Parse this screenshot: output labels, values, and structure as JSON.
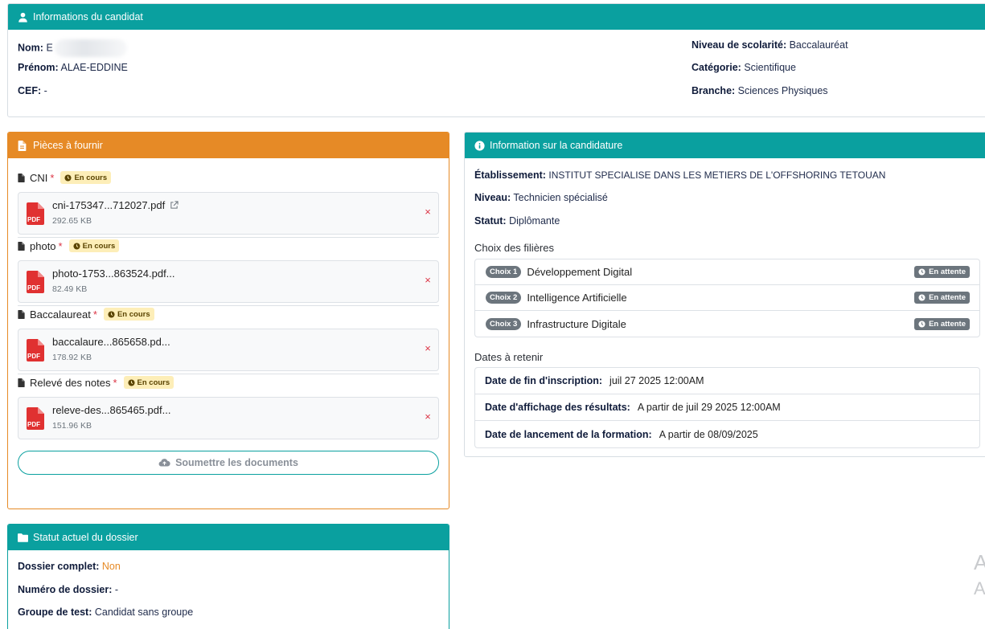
{
  "candidate": {
    "title": "Informations du candidat",
    "nom_label": "Nom:",
    "nom_value": "E",
    "prenom_label": "Prénom:",
    "prenom_value": "ALAE-EDDINE",
    "cef_label": "CEF:",
    "cef_value": "-",
    "niveau_scolarite_label": "Niveau de scolarité:",
    "niveau_scolarite_value": "Baccalauréat",
    "categorie_label": "Catégorie:",
    "categorie_value": "Scientifique",
    "branche_label": "Branche:",
    "branche_value": "Sciences Physiques"
  },
  "documents": {
    "title": "Pièces à fournir",
    "required_mark": "*",
    "items": [
      {
        "label": "CNI",
        "status": "En cours",
        "file_name": "cni-175347...712027.pdf",
        "file_size": "292.65 KB",
        "pdf_label": "PDF"
      },
      {
        "label": "photo",
        "status": "En cours",
        "file_name": "photo-1753...863524.pdf...",
        "file_size": "82.49 KB",
        "pdf_label": "PDF"
      },
      {
        "label": "Baccalaureat",
        "status": "En cours",
        "file_name": "baccalaure...865658.pd...",
        "file_size": "178.92 KB",
        "pdf_label": "PDF"
      },
      {
        "label": "Relevé des notes",
        "status": "En cours",
        "file_name": "releve-des...865465.pdf...",
        "file_size": "151.96 KB",
        "pdf_label": "PDF"
      }
    ],
    "remove_symbol": "×",
    "submit_label": "Soumettre les documents"
  },
  "application": {
    "title": "Information sur la candidature",
    "etablissement_label": "Établissement:",
    "etablissement_value": "INSTITUT SPECIALISE DANS LES METIERS DE L'OFFSHORING TETOUAN",
    "niveau_label": "Niveau:",
    "niveau_value": "Technicien spécialisé",
    "statut_label": "Statut:",
    "statut_value": "Diplômante",
    "filieres_title": "Choix des filières",
    "filieres": [
      {
        "choice": "Choix 1",
        "name": "Développement Digital",
        "status": "En attente"
      },
      {
        "choice": "Choix 2",
        "name": "Intelligence Artificielle",
        "status": "En attente"
      },
      {
        "choice": "Choix 3",
        "name": "Infrastructure Digitale",
        "status": "En attente"
      }
    ],
    "dates_title": "Dates à retenir",
    "dates": [
      {
        "label": "Date de fin d'inscription:",
        "value": "juil 27 2025 12:00AM"
      },
      {
        "label": "Date d'affichage des résultats:",
        "value": "A partir de juil 29 2025 12:00AM"
      },
      {
        "label": "Date de lancement de la formation:",
        "value": "A partir de 08/09/2025"
      }
    ]
  },
  "dossier": {
    "title": "Statut actuel du dossier",
    "complet_label": "Dossier complet:",
    "complet_value": "Non",
    "numero_label": "Numéro de dossier:",
    "numero_value": "-",
    "groupe_label": "Groupe de test:",
    "groupe_value": "Candidat sans groupe"
  },
  "watermark": {
    "line1": "A",
    "line2": "A"
  },
  "colors": {
    "teal": "#0aa09f",
    "orange": "#e68a26",
    "danger": "#dc3545",
    "pending_badge": "#fdeeb8",
    "grey_badge": "#6c757d"
  }
}
